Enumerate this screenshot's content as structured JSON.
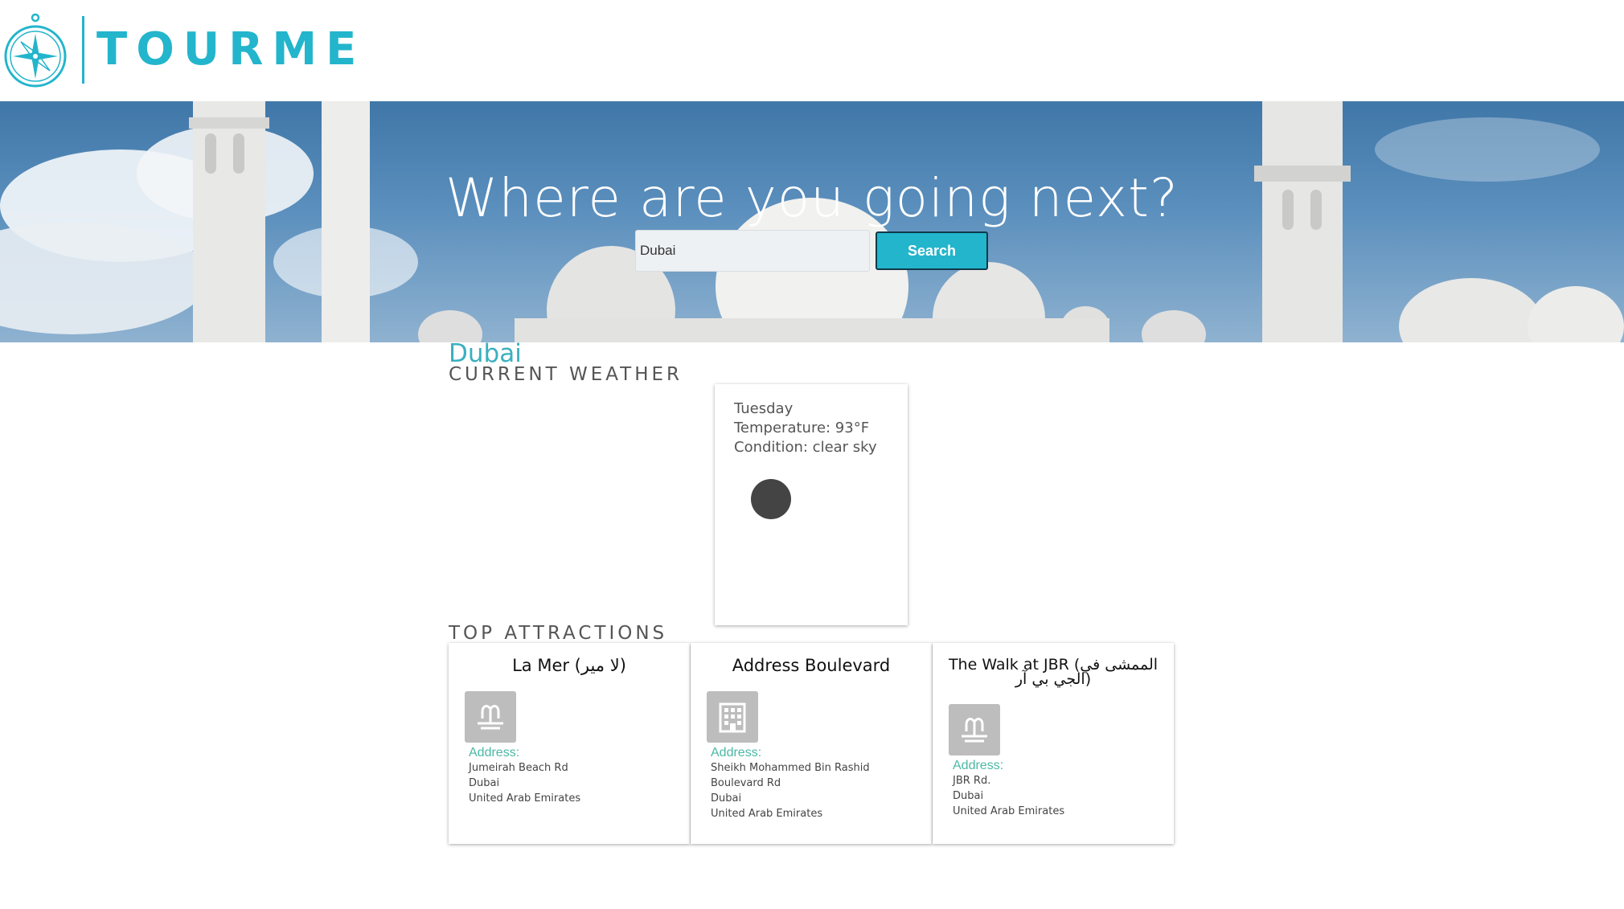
{
  "brand": {
    "name": "TOURME",
    "color": "#23b5cc",
    "logo_icon": "compass-icon"
  },
  "hero": {
    "title": "Where are you going next?",
    "background": "mosque-domes-photo",
    "search": {
      "value": "Dubai",
      "placeholder": "",
      "button_label": "Search"
    }
  },
  "city": {
    "name": "Dubai"
  },
  "weather": {
    "section_title": "CURRENT WEATHER",
    "day": "Tuesday",
    "temperature": "Temperature: 93°F",
    "condition": "Condition: clear sky",
    "icon": "clear-sky-icon"
  },
  "attractions": {
    "section_title": "TOP ATTRACTIONS",
    "address_label": "Address:",
    "items": [
      {
        "name": "La Mer (لا مير)",
        "icon": "fountain-icon",
        "address": [
          "Jumeirah Beach Rd",
          "Dubai",
          "United Arab Emirates"
        ]
      },
      {
        "name": "Address Boulevard",
        "icon": "hotel-building-icon",
        "address": [
          "Sheikh Mohammed Bin Rashid",
          "Boulevard Rd",
          "Dubai",
          "United Arab Emirates"
        ]
      },
      {
        "name": "The Walk at JBR (الممشى في الجي بي آر)",
        "icon": "fountain-icon",
        "address": [
          "JBR Rd.",
          "Dubai",
          "United Arab Emirates"
        ]
      }
    ]
  }
}
